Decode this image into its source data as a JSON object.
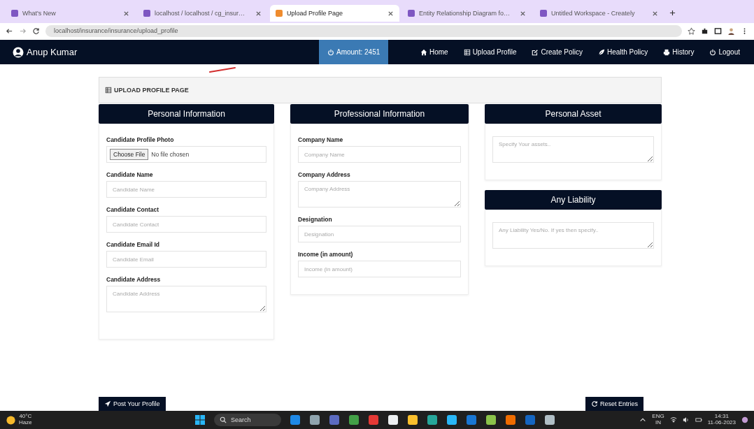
{
  "browser": {
    "tabs": [
      {
        "title": "What's New",
        "selected": false
      },
      {
        "title": "localhost / localhost / cg_insur…",
        "selected": false
      },
      {
        "title": "Upload Profile Page",
        "selected": true
      },
      {
        "title": "Entity Relationship Diagram fo…",
        "selected": false
      },
      {
        "title": "Untitled Workspace - Creately",
        "selected": false
      }
    ],
    "url": "localhost/insurance/insurance/upload_profile"
  },
  "navbar": {
    "brand": "Anup Kumar",
    "amount": "Amount: 2451",
    "links": [
      {
        "label": "Home",
        "kind": "home"
      },
      {
        "label": "Upload Profile",
        "kind": "table"
      },
      {
        "label": "Create Policy",
        "kind": "edit"
      },
      {
        "label": "Health Policy",
        "kind": "leaf"
      },
      {
        "label": "History",
        "kind": "print"
      },
      {
        "label": "Logout",
        "kind": "power"
      }
    ]
  },
  "page_title": "UPLOAD PROFILE PAGE",
  "columns": [
    {
      "sections": [
        {
          "title": "Personal Information",
          "fields": [
            {
              "kind": "file",
              "label": "Candidate Profile Photo",
              "button": "Choose File",
              "status": "No file chosen"
            },
            {
              "kind": "input",
              "label": "Candidate Name",
              "placeholder": "Candidate Name"
            },
            {
              "kind": "input",
              "label": "Candidate Contact",
              "placeholder": "Candidate Contact"
            },
            {
              "kind": "input",
              "label": "Candidate Email Id",
              "placeholder": "Candidate Email"
            },
            {
              "kind": "textarea",
              "label": "Candidate Address",
              "placeholder": "Candidate Address"
            }
          ]
        }
      ]
    },
    {
      "sections": [
        {
          "title": "Professional Information",
          "fields": [
            {
              "kind": "input",
              "label": "Company Name",
              "placeholder": "Company Name"
            },
            {
              "kind": "textarea",
              "label": "Company Address",
              "placeholder": "Company Address"
            },
            {
              "kind": "input",
              "label": "Designation",
              "placeholder": "Designation"
            },
            {
              "kind": "input",
              "label": "Income (in amount)",
              "placeholder": "Income (in amount)"
            }
          ]
        }
      ]
    },
    {
      "sections": [
        {
          "title": "Personal Asset",
          "fields": [
            {
              "kind": "textarea",
              "placeholder": "Specify Your assets.."
            }
          ]
        },
        {
          "title": "Any Liability",
          "fields": [
            {
              "kind": "textarea",
              "placeholder": "Any Liability Yes/No. If yes then specify.."
            }
          ]
        }
      ]
    }
  ],
  "actions": {
    "post": "Post Your Profile",
    "reset": "Reset Entries"
  },
  "taskbar": {
    "temperature": "40°C",
    "condition": "Haze",
    "search": "Search",
    "language": "ENG",
    "region": "IN",
    "time": "14:31",
    "date": "11-06-2023"
  }
}
